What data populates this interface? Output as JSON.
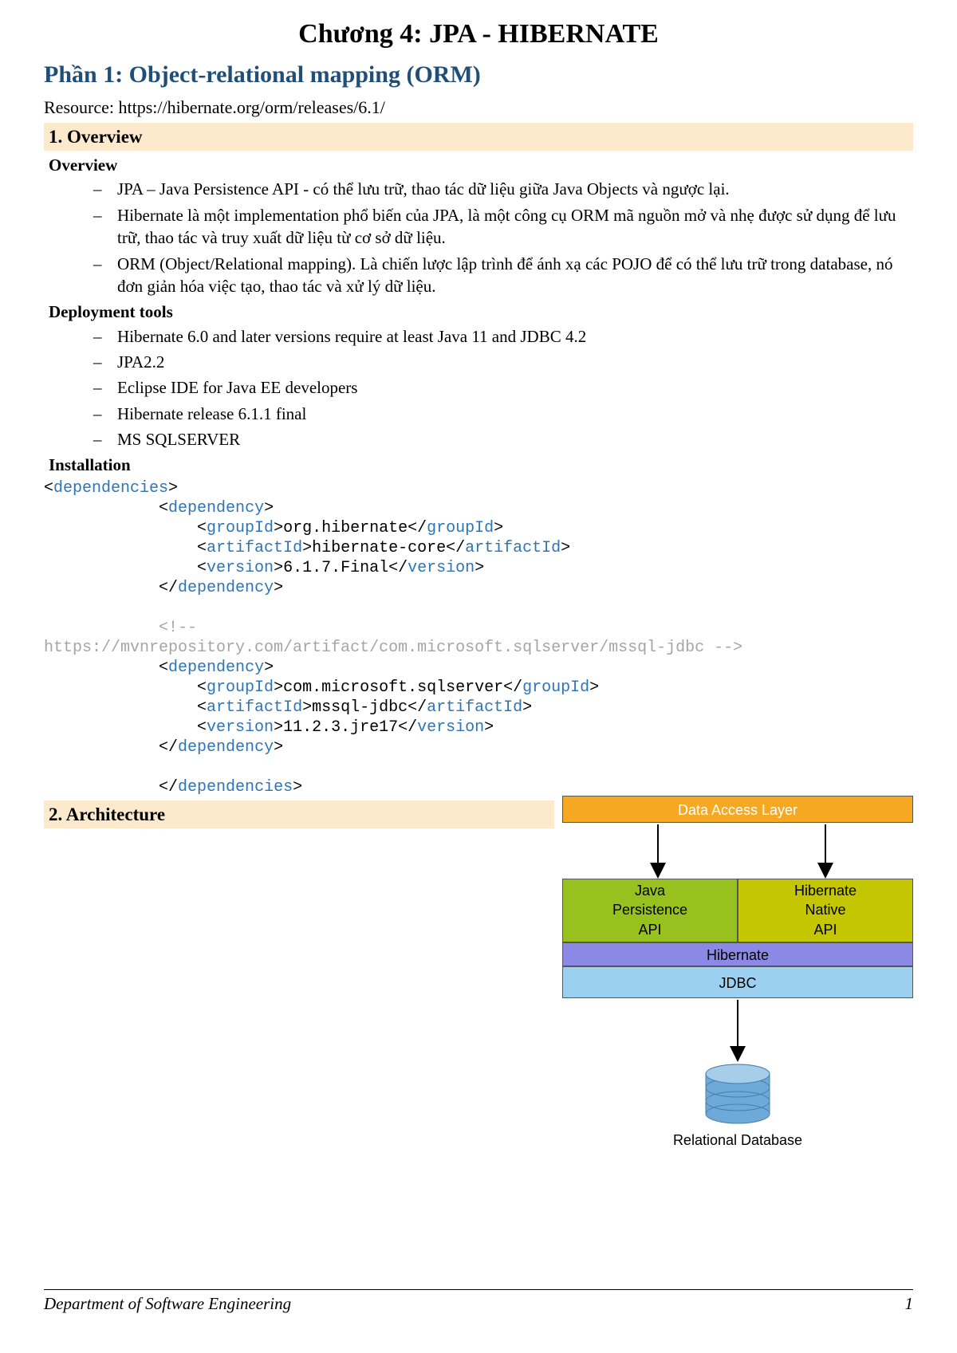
{
  "title": "Chương 4: JPA - HIBERNATE",
  "part": "Phần 1: Object-relational mapping (ORM)",
  "resource_label": "Resource: ",
  "resource_url": "https://hibernate.org/orm/releases/6.1/",
  "section1_head": "1.  Overview",
  "overview_head": "Overview",
  "overview_items": [
    "JPA – Java Persistence API - có thể lưu trữ, thao tác dữ liệu giữa Java Objects và ngược lại.",
    "Hibernate là một implementation phổ biến của JPA, là một công cụ ORM mã nguồn mở và nhẹ được sử dụng để lưu trữ, thao tác và truy xuất dữ liệu từ cơ sở dữ liệu.",
    "ORM (Object/Relational mapping). Là chiến lược lập trình để ánh xạ các POJO để có thể lưu trữ trong database, nó đơn giản hóa việc tạo, thao tác và xử lý dữ liệu."
  ],
  "deploy_head": "Deployment tools",
  "deploy_items": [
    "Hibernate 6.0 and later versions require at least Java 11 and JDBC 4.2",
    "JPA2.2",
    "Eclipse IDE for Java EE developers",
    "Hibernate release 6.1.1 final",
    "MS SQLSERVER"
  ],
  "install_head": "Installation",
  "code": {
    "tags": {
      "dependencies_o": "dependencies",
      "dependencies_c": "dependencies",
      "dependency_o": "dependency",
      "dependency_c": "dependency",
      "groupId_o": "groupId",
      "groupId_c": "groupId",
      "artifactId_o": "artifactId",
      "artifactId_c": "artifactId",
      "version_o": "version",
      "version_c": "version"
    },
    "dep1_group": "org.hibernate",
    "dep1_artifact": "hibernate-core",
    "dep1_version": "6.1.7.Final",
    "comment_open": "<!--",
    "comment_body": "https://mvnrepository.com/artifact/com.microsoft.sqlserver/mssql-jdbc -->",
    "dep2_group": "com.microsoft.sqlserver",
    "dep2_artifact": "mssql-jdbc",
    "dep2_version": "11.2.3.jre17"
  },
  "section2_head": "2.  Architecture",
  "diagram": {
    "dal": "Data Access Layer",
    "jpa": "Java\nPersistence\nAPI",
    "native": "Hibernate\nNative\nAPI",
    "hibernate": "Hibernate",
    "jdbc": "JDBC",
    "db": "Relational Database"
  },
  "footer_left": "Department of Software Engineering",
  "footer_right": "1"
}
